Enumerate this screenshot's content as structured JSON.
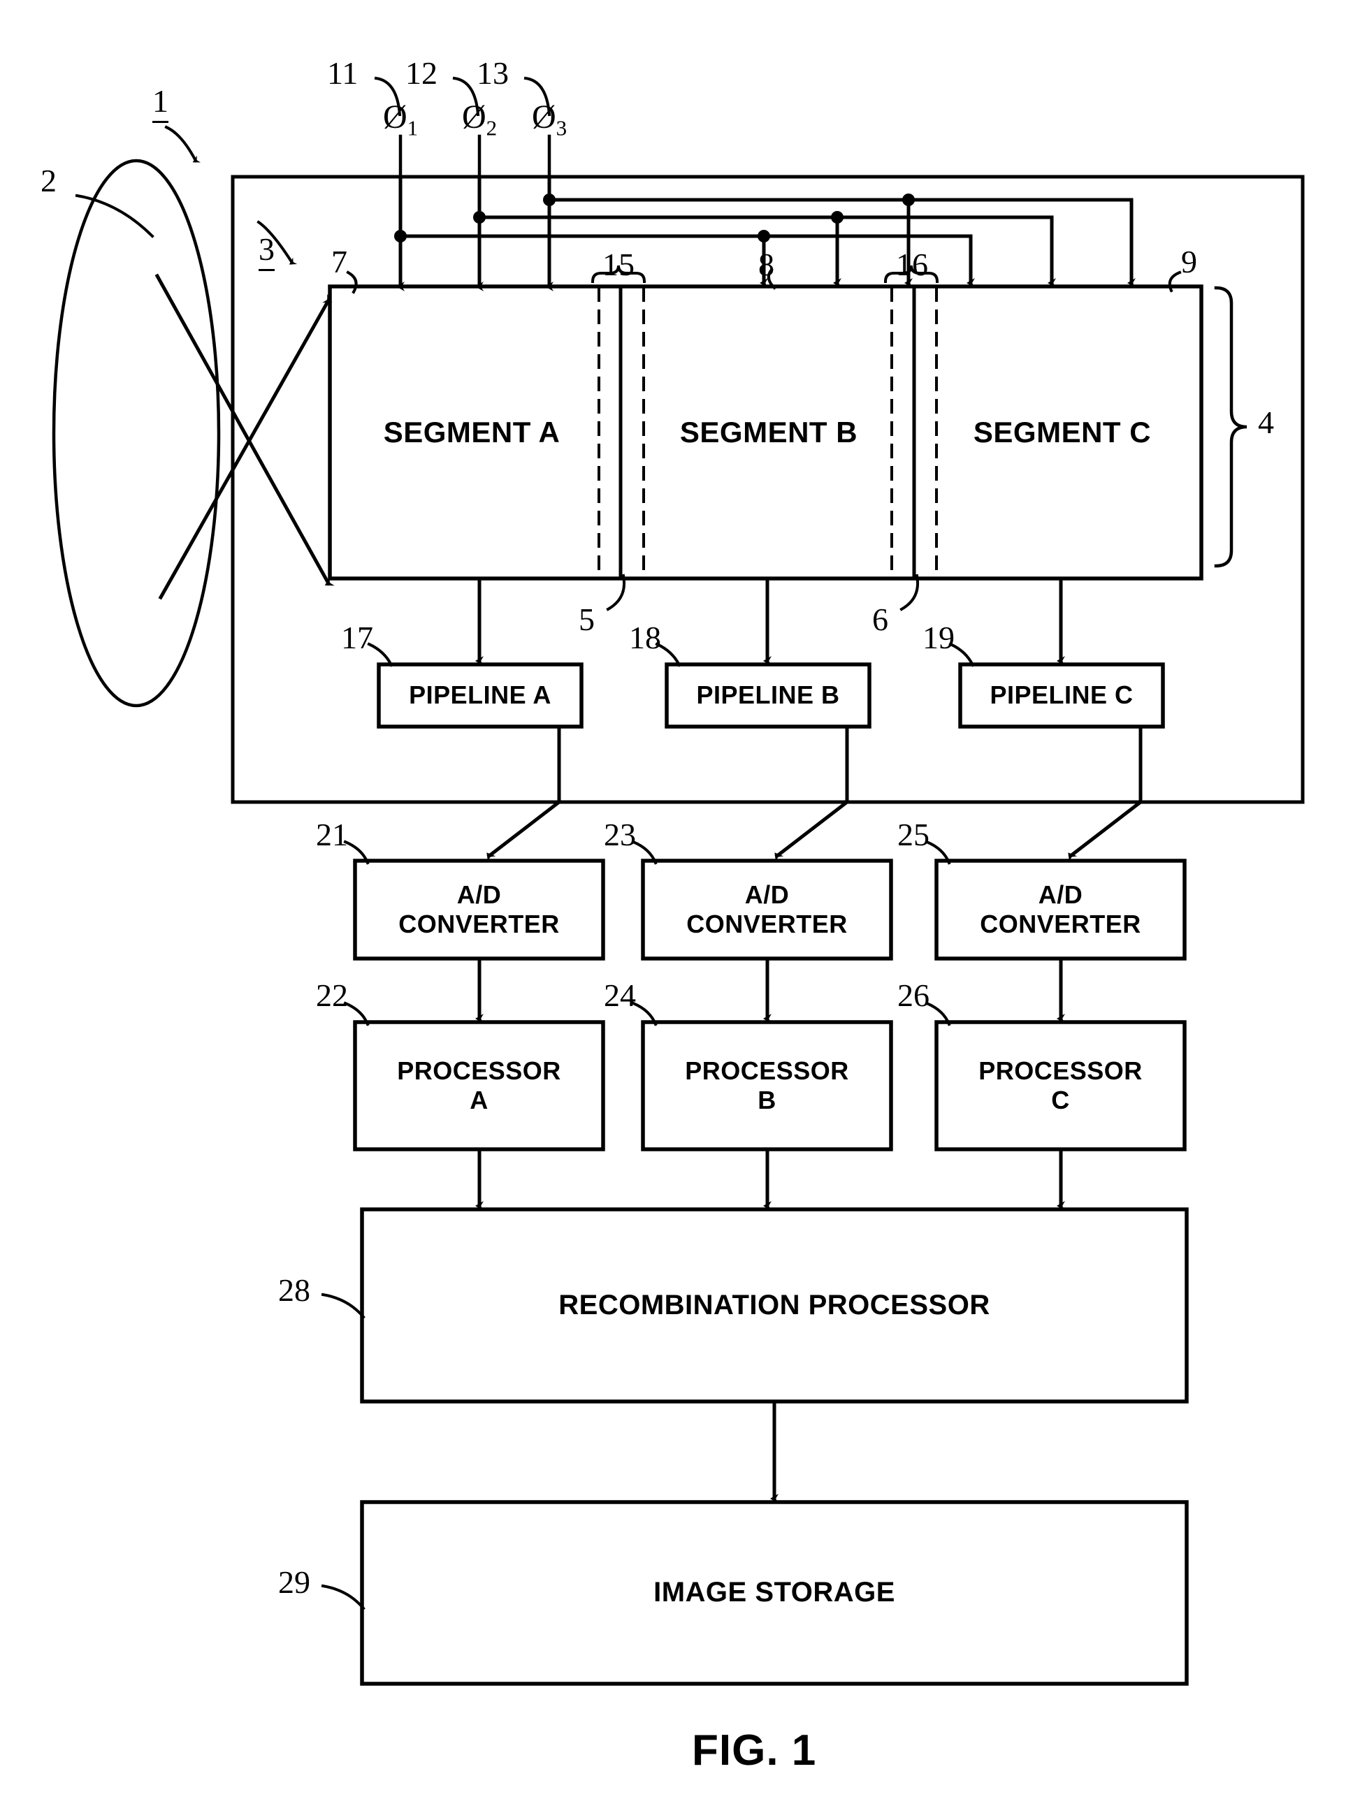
{
  "figure": {
    "caption": "FIG. 1",
    "title_ref": "1"
  },
  "optics": {
    "lens_ref": "2",
    "lens_name": "lens-ellipse"
  },
  "camera": {
    "outer_ref": "3",
    "sensor_array_ref": "4",
    "sensor_top_left_ref": "7",
    "sensor_top_right_ref": "9",
    "boundary_a_b_ref": "5",
    "boundary_b_c_ref": "6",
    "overlap_left_ref": "15",
    "overlap_right_ref": "16",
    "mid_column_ref": "8"
  },
  "clocks": [
    {
      "ref": "11",
      "symbol": "Ø",
      "index": "1",
      "name": "phase-1"
    },
    {
      "ref": "12",
      "symbol": "Ø",
      "index": "2",
      "name": "phase-2"
    },
    {
      "ref": "13",
      "symbol": "Ø",
      "index": "3",
      "name": "phase-3"
    }
  ],
  "segments": [
    {
      "label": "SEGMENT A",
      "name": "segment-a"
    },
    {
      "label": "SEGMENT B",
      "name": "segment-b"
    },
    {
      "label": "SEGMENT C",
      "name": "segment-c"
    }
  ],
  "pipelines": [
    {
      "label": "PIPELINE A",
      "ref": "17",
      "name": "pipeline-a"
    },
    {
      "label": "PIPELINE B",
      "ref": "18",
      "name": "pipeline-b"
    },
    {
      "label": "PIPELINE C",
      "ref": "19",
      "name": "pipeline-c"
    }
  ],
  "converters": [
    {
      "line1": "A/D",
      "line2": "CONVERTER",
      "ref": "21",
      "name": "ad-converter-a"
    },
    {
      "line1": "A/D",
      "line2": "CONVERTER",
      "ref": "23",
      "name": "ad-converter-b"
    },
    {
      "line1": "A/D",
      "line2": "CONVERTER",
      "ref": "25",
      "name": "ad-converter-c"
    }
  ],
  "processors": [
    {
      "line1": "PROCESSOR",
      "line2": "A",
      "ref": "22",
      "name": "processor-a"
    },
    {
      "line1": "PROCESSOR",
      "line2": "B",
      "ref": "24",
      "name": "processor-b"
    },
    {
      "line1": "PROCESSOR",
      "line2": "C",
      "ref": "26",
      "name": "processor-c"
    }
  ],
  "recombination": {
    "label": "RECOMBINATION PROCESSOR",
    "ref": "28",
    "name": "recombination-processor"
  },
  "storage": {
    "label": "IMAGE STORAGE",
    "ref": "29",
    "name": "image-storage"
  },
  "colors": {
    "ink": "#000000",
    "paper": "#ffffff"
  }
}
